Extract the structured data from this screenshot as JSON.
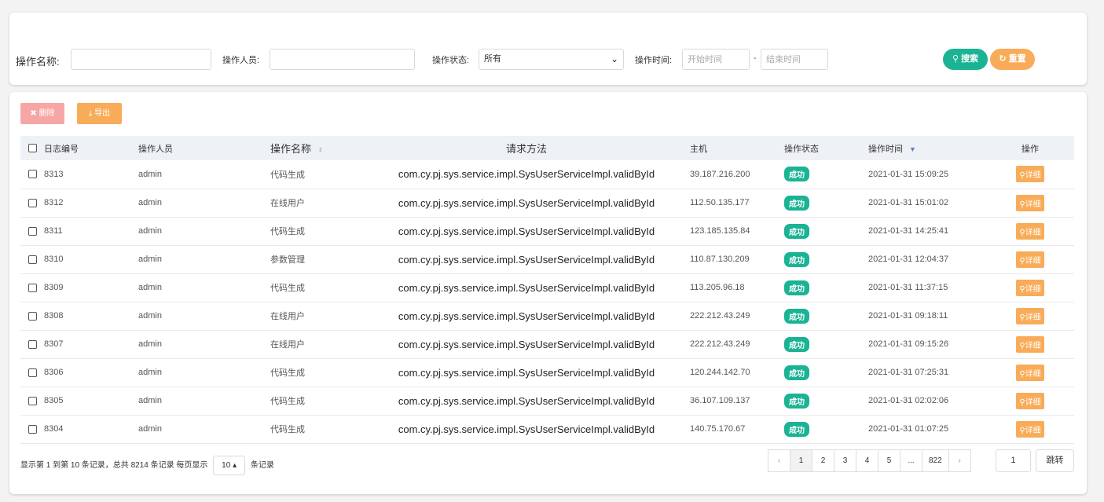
{
  "search": {
    "op_name_label": "操作名称:",
    "op_name_value": "",
    "operator_label": "操作人员:",
    "operator_value": "",
    "status_label": "操作状态:",
    "status_value": "所有",
    "time_label": "操作时间:",
    "start_placeholder": "开始时间",
    "range_dash": "-",
    "end_placeholder": "结束时间",
    "search_label": "搜索",
    "reset_label": "重置"
  },
  "toolbar": {
    "delete_label": "删除",
    "export_label": "导出"
  },
  "table": {
    "headers": {
      "id": "日志编号",
      "operator": "操作人员",
      "op_name": "操作名称",
      "method": "请求方法",
      "host": "主机",
      "status": "操作状态",
      "time": "操作时间",
      "action": "操作"
    },
    "rows": [
      {
        "id": "8313",
        "operator": "admin",
        "op_name": "代码生成",
        "method": "com.cy.pj.sys.service.impl.SysUserServiceImpl.validById",
        "host": "39.187.216.200",
        "status": "成功",
        "time": "2021-01-31 15:09:25",
        "action": "详细"
      },
      {
        "id": "8312",
        "operator": "admin",
        "op_name": "在线用户",
        "method": "com.cy.pj.sys.service.impl.SysUserServiceImpl.validById",
        "host": "112.50.135.177",
        "status": "成功",
        "time": "2021-01-31 15:01:02",
        "action": "详细"
      },
      {
        "id": "8311",
        "operator": "admin",
        "op_name": "代码生成",
        "method": "com.cy.pj.sys.service.impl.SysUserServiceImpl.validById",
        "host": "123.185.135.84",
        "status": "成功",
        "time": "2021-01-31 14:25:41",
        "action": "详细"
      },
      {
        "id": "8310",
        "operator": "admin",
        "op_name": "参数管理",
        "method": "com.cy.pj.sys.service.impl.SysUserServiceImpl.validById",
        "host": "110.87.130.209",
        "status": "成功",
        "time": "2021-01-31 12:04:37",
        "action": "详细"
      },
      {
        "id": "8309",
        "operator": "admin",
        "op_name": "代码生成",
        "method": "com.cy.pj.sys.service.impl.SysUserServiceImpl.validById",
        "host": "113.205.96.18",
        "status": "成功",
        "time": "2021-01-31 11:37:15",
        "action": "详细"
      },
      {
        "id": "8308",
        "operator": "admin",
        "op_name": "在线用户",
        "method": "com.cy.pj.sys.service.impl.SysUserServiceImpl.validById",
        "host": "222.212.43.249",
        "status": "成功",
        "time": "2021-01-31 09:18:11",
        "action": "详细"
      },
      {
        "id": "8307",
        "operator": "admin",
        "op_name": "在线用户",
        "method": "com.cy.pj.sys.service.impl.SysUserServiceImpl.validById",
        "host": "222.212.43.249",
        "status": "成功",
        "time": "2021-01-31 09:15:26",
        "action": "详细"
      },
      {
        "id": "8306",
        "operator": "admin",
        "op_name": "代码生成",
        "method": "com.cy.pj.sys.service.impl.SysUserServiceImpl.validById",
        "host": "120.244.142.70",
        "status": "成功",
        "time": "2021-01-31 07:25:31",
        "action": "详细"
      },
      {
        "id": "8305",
        "operator": "admin",
        "op_name": "代码生成",
        "method": "com.cy.pj.sys.service.impl.SysUserServiceImpl.validById",
        "host": "36.107.109.137",
        "status": "成功",
        "time": "2021-01-31 02:02:06",
        "action": "详细"
      },
      {
        "id": "8304",
        "operator": "admin",
        "op_name": "代码生成",
        "method": "com.cy.pj.sys.service.impl.SysUserServiceImpl.validById",
        "host": "140.75.170.67",
        "status": "成功",
        "time": "2021-01-31 01:07:25",
        "action": "详细"
      }
    ]
  },
  "footer": {
    "info_prefix": "显示第 1 到第 10 条记录，总共 8214 条记录  每页显示",
    "page_size": "10",
    "info_suffix": "条记录",
    "pages": [
      "1",
      "2",
      "3",
      "4",
      "5",
      "...",
      "822"
    ],
    "prev": "‹",
    "next": "›",
    "jump_value": "1",
    "jump_label": "跳转"
  },
  "colors": {
    "primary": "#1ab394",
    "warning": "#f8ac59",
    "danger_light": "#f7a6a6"
  }
}
